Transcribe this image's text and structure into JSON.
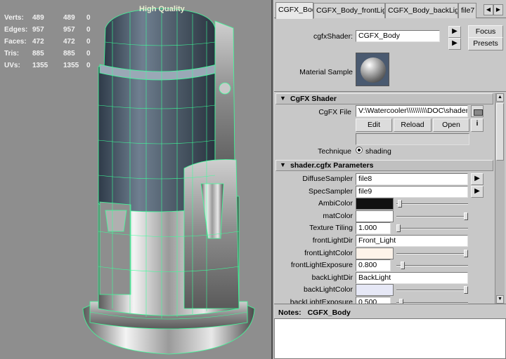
{
  "viewport": {
    "quality_label": "High Quality",
    "stats": [
      {
        "label": "Verts:",
        "values": [
          "489",
          "489",
          "0"
        ]
      },
      {
        "label": "Edges:",
        "values": [
          "957",
          "957",
          "0"
        ]
      },
      {
        "label": "Faces:",
        "values": [
          "472",
          "472",
          "0"
        ]
      },
      {
        "label": "Tris:",
        "values": [
          "885",
          "885",
          "0"
        ]
      },
      {
        "label": "UVs:",
        "values": [
          "1355",
          "1355",
          "0"
        ]
      }
    ]
  },
  "tabs": [
    {
      "label": "CGFX_Body",
      "active": true
    },
    {
      "label": "CGFX_Body_frontLightDir",
      "active": false
    },
    {
      "label": "CGFX_Body_backLightDir",
      "active": false
    },
    {
      "label": "file7",
      "active": false
    }
  ],
  "header": {
    "shader_label": "cgfxShader:",
    "shader_value": "CGFX_Body",
    "focus_label": "Focus",
    "presets_label": "Presets",
    "material_sample_label": "Material Sample"
  },
  "cgfx_section": {
    "title": "CgFX Shader",
    "file_label": "CgFX File",
    "file_value": "V:\\Watercooler\\\\\\\\\\\\\\\\\\\\DOC\\shader.cg",
    "edit_label": "Edit",
    "reload_label": "Reload",
    "open_label": "Open",
    "info_glyph": "i",
    "technique_label": "Technique",
    "technique_value": "shading"
  },
  "params_section": {
    "title": "shader.cgfx Parameters",
    "rows": [
      {
        "label": "DiffuseSampler",
        "kind": "text",
        "value": "file8",
        "button": true
      },
      {
        "label": "SpecSampler",
        "kind": "text",
        "value": "file9",
        "button": true
      },
      {
        "label": "AmbiColor",
        "kind": "color",
        "color": "#111111",
        "slider": 0.02
      },
      {
        "label": "matColor",
        "kind": "color",
        "color": "#ffffff",
        "slider": 1.0
      },
      {
        "label": "Texture Tiling",
        "kind": "number",
        "value": "1.000",
        "slider": 0.0
      },
      {
        "label": "frontLightDir",
        "kind": "text",
        "value": "Front_Light",
        "button": false
      },
      {
        "label": "frontLightColor",
        "kind": "color",
        "color": "#fdf3ea",
        "slider": 1.0
      },
      {
        "label": "frontLightExposure",
        "kind": "number",
        "value": "0.800",
        "slider": 0.06
      },
      {
        "label": "backLightDir",
        "kind": "text",
        "value": "BackLight",
        "button": false
      },
      {
        "label": "backLightColor",
        "kind": "color",
        "color": "#e6e8f6",
        "slider": 1.0
      },
      {
        "label": "backLightExposure",
        "kind": "number",
        "value": "0.500",
        "slider": 0.04
      }
    ]
  },
  "notes": {
    "label": "Notes:",
    "node": "CGFX_Body"
  },
  "colors": {
    "viewport_bg": "#8e8e8e",
    "wireframe": "#3cff9a",
    "panel_bg": "#c8c8c8"
  }
}
